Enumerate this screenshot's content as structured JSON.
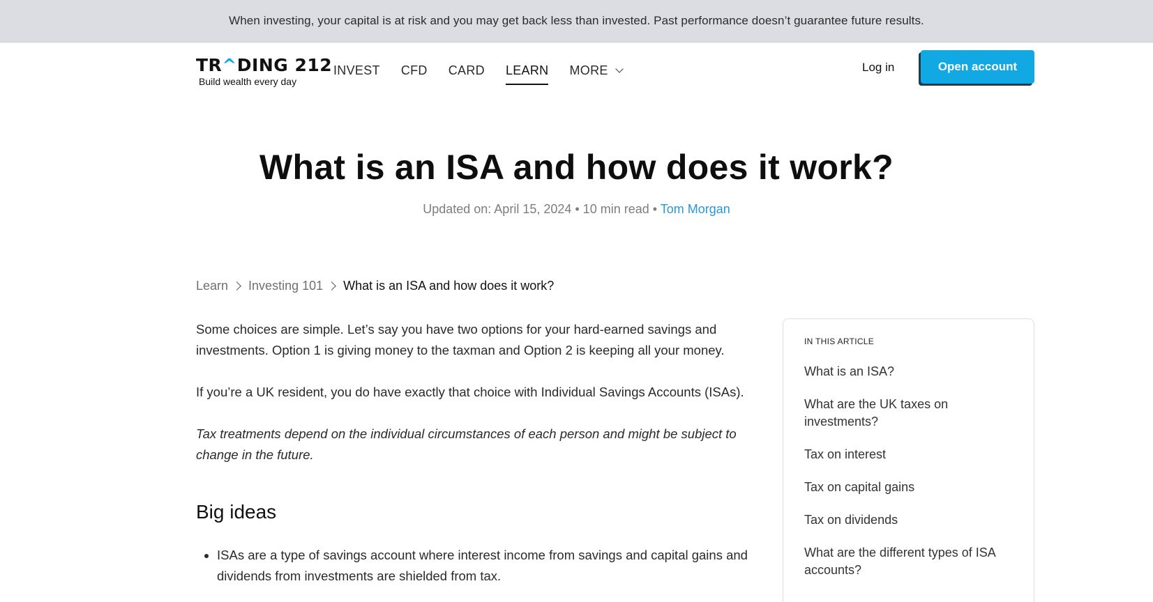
{
  "banner": {
    "text": "When investing, your capital is at risk and you may get back less than invested. Past performance doesn’t guarantee future results."
  },
  "header": {
    "logo": {
      "word_start": "TR",
      "word_caret": "^",
      "word_end": "DING 212",
      "tagline": "Build wealth every day"
    },
    "nav": [
      {
        "label": "INVEST"
      },
      {
        "label": "CFD"
      },
      {
        "label": "CARD"
      },
      {
        "label": "LEARN",
        "active": true
      },
      {
        "label": "MORE"
      }
    ],
    "login_label": "Log in",
    "open_account_label": "Open account"
  },
  "article": {
    "title": "What is an ISA and how does it work?",
    "meta": {
      "updated": "Updated on: April 15, 2024 • 10 min read • ",
      "author": "Tom Morgan"
    },
    "breadcrumb": [
      {
        "label": "Learn"
      },
      {
        "label": "Investing 101"
      },
      {
        "label": "What is an ISA and how does it work?"
      }
    ],
    "paragraphs": [
      "Some choices are simple. Let’s say you have two options for your hard-earned savings and investments. Option 1 is giving money to the taxman and Option 2 is keeping all your money.",
      "If you’re a UK resident, you do have exactly that choice with Individual Savings Accounts (ISAs).",
      "Tax treatments depend on the individual circumstances of each person and might be subject to change in the future."
    ],
    "section_heading": "Big ideas",
    "bullets": [
      "ISAs are a type of savings account where interest income from savings and capital gains and dividends from investments are shielded from tax."
    ]
  },
  "toc": {
    "heading": "IN THIS ARTICLE",
    "items": [
      "What is an ISA?",
      "What are the UK taxes on investments?",
      "Tax on interest",
      "Tax on capital gains",
      "Tax on dividends",
      "What are the different types of ISA accounts?"
    ]
  },
  "colors": {
    "accent": "#12a8e3",
    "author_link": "#2a97d6",
    "banner_bg": "#dcdde2"
  },
  "icons": [
    "chevron-down-icon",
    "breadcrumb-chevron-icon"
  ]
}
